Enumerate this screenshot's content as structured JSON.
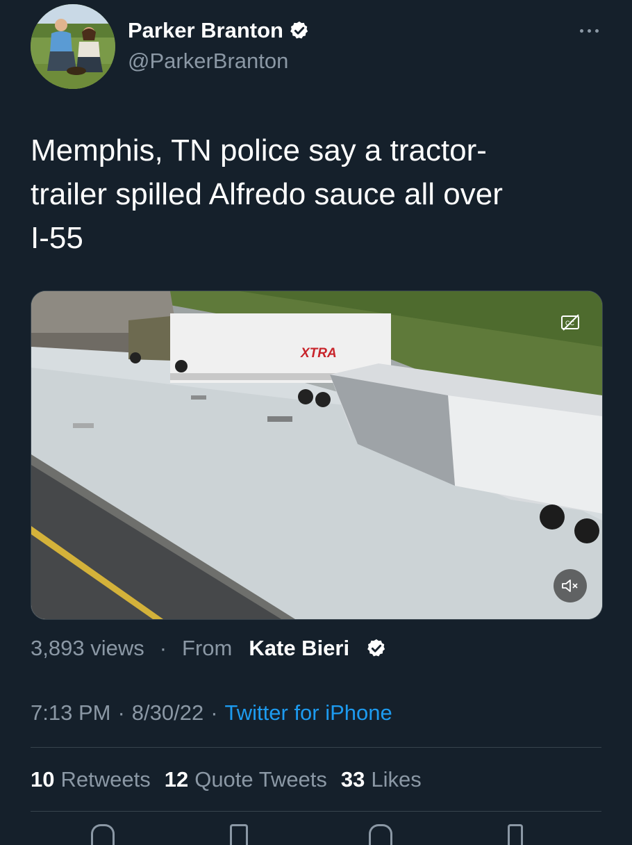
{
  "author": {
    "name": "Parker Branton",
    "handle": "@ParkerBranton",
    "verified": true,
    "avatar": "avatar-photo"
  },
  "tweet": {
    "text": "Memphis, TN police say a tractor-\ntrailer spilled Alfredo sauce all over\nI-55"
  },
  "media": {
    "type": "video",
    "description_icon": "closed-captions-icon",
    "mute_icon": "speaker-muted-icon",
    "truck_logo": "XTRA"
  },
  "meta": {
    "views": "3,893 views",
    "dot": "·",
    "from_label": "From",
    "from_name": "Kate Bieri",
    "from_verified": true,
    "time": "7:13 PM",
    "date": "8/30/22",
    "sep": "·",
    "source": "Twitter for iPhone"
  },
  "stats": {
    "retweets_count": "10",
    "retweets_label": "Retweets",
    "quotes_count": "12",
    "quotes_label": "Quote Tweets",
    "likes_count": "33",
    "likes_label": "Likes"
  },
  "colors": {
    "background": "#15202b",
    "secondary_text": "#8b98a5",
    "accent": "#1d9bf0",
    "divider": "#38444d"
  }
}
